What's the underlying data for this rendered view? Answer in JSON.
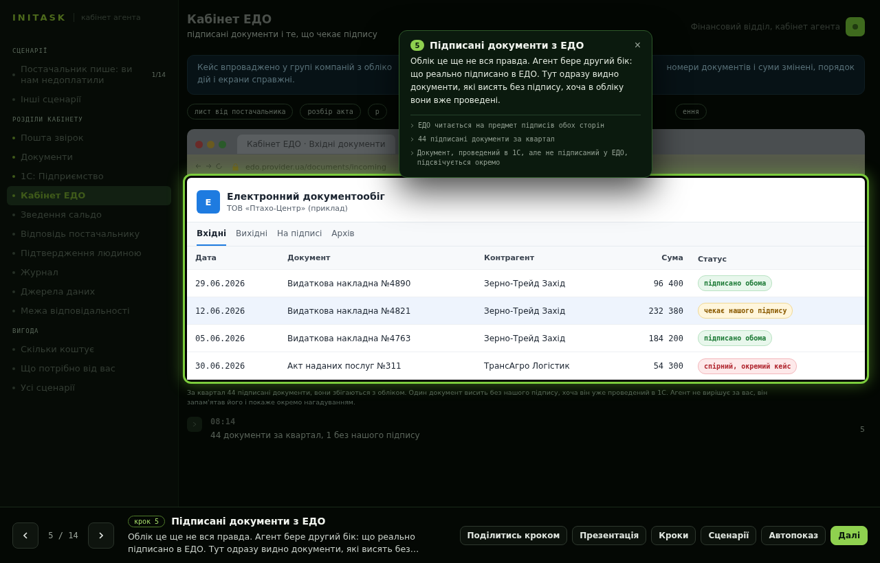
{
  "sidebar": {
    "logo": "INITASK",
    "subtitle": "кабінет агента",
    "sections": [
      {
        "title": "СЦЕНАРІЇ",
        "items": [
          {
            "label": "Постачальник пише: ви нам недоплатили",
            "count": "1/14",
            "selected": false,
            "done": false
          },
          {
            "label": "Інші сценарії",
            "selected": false,
            "done": false
          }
        ]
      },
      {
        "title": "РОЗДІЛИ КАБІНЕТУ",
        "items": [
          {
            "label": "Пошта звірок",
            "selected": false,
            "done": true
          },
          {
            "label": "Документи",
            "selected": false,
            "done": true
          },
          {
            "label": "1С: Підприємство",
            "selected": false,
            "done": true
          },
          {
            "label": "Кабінет ЕДО",
            "selected": true,
            "done": true
          },
          {
            "label": "Зведення сальдо",
            "selected": false,
            "done": false
          },
          {
            "label": "Відповідь постачальнику",
            "selected": false,
            "done": false
          },
          {
            "label": "Підтвердження людиною",
            "selected": false,
            "done": false
          },
          {
            "label": "Журнал",
            "selected": false,
            "done": false
          },
          {
            "label": "Джерела даних",
            "selected": false,
            "done": false
          },
          {
            "label": "Межа відповідальності",
            "selected": false,
            "done": false
          }
        ]
      },
      {
        "title": "ВИГОДА",
        "items": [
          {
            "label": "Скільки коштує",
            "selected": false,
            "done": false
          },
          {
            "label": "Що потрібно від вас",
            "selected": false,
            "done": false
          },
          {
            "label": "Усі сценарії",
            "selected": false,
            "done": false
          }
        ]
      }
    ]
  },
  "header": {
    "title": "Кабінет ЕДО",
    "subtitle": "підписані документи і те, що чекає підпису",
    "account": "Фінансовий відділ, кабінет агента"
  },
  "intro": {
    "text_start": "Кейс впроваджено у групі компаній з обліко",
    "text_end": "номери документів і суми змінені, порядок",
    "text_line2": "дій і екрани справжні."
  },
  "chips": [
    "лист від постачальника",
    "розбір акта",
    "р",
    "ення"
  ],
  "browser": {
    "tab": "Кабінет ЕДО · Вхідні документи",
    "url": "edo.provider.ua/documents/incoming"
  },
  "edo": {
    "logo": "Е",
    "title": "Електронний документообіг",
    "company": "ТОВ «Птахо-Центр» (приклад)",
    "tabs": [
      {
        "label": "Вхідні",
        "selected": true
      },
      {
        "label": "Вихідні",
        "selected": false
      },
      {
        "label": "На підписі",
        "selected": false
      },
      {
        "label": "Архів",
        "selected": false
      }
    ],
    "columns": [
      "Дата",
      "Документ",
      "Контрагент",
      "Сума",
      "Статус"
    ],
    "rows": [
      {
        "date": "29.06.2026",
        "document": "Видаткова накладна №4890",
        "counterparty": "Зерно-Трейд Захід",
        "sum": "96 400",
        "status": "підписано обома",
        "kind": "signed",
        "selected": false
      },
      {
        "date": "12.06.2026",
        "document": "Видаткова накладна №4821",
        "counterparty": "Зерно-Трейд Захід",
        "sum": "232 380",
        "status": "чекає нашого підпису",
        "kind": "pending",
        "selected": true
      },
      {
        "date": "05.06.2026",
        "document": "Видаткова накладна №4763",
        "counterparty": "Зерно-Трейд Захід",
        "sum": "184 200",
        "status": "підписано обома",
        "kind": "signed",
        "selected": false
      },
      {
        "date": "30.06.2026",
        "document": "Акт наданих послуг №311",
        "counterparty": "ТрансАгро Логістик",
        "sum": "54 300",
        "status": "спірний, окремий кейс",
        "kind": "disputed",
        "selected": false
      }
    ]
  },
  "note": "За квартал 44 підписані документи, вони збігаються з обліком. Один документ висить без нашого підпису, хоча він уже проведений в 1С. Агент не вирішує за вас, він",
  "note_line2": "запам'ятав його і покаже окремо нагадуванням.",
  "log": {
    "time": "08:14",
    "text": "44 документи за квартал, 1 без нашого підпису",
    "count": "5"
  },
  "tooltip": {
    "step": "5",
    "title": "Підписані документи з ЕДО",
    "close": "×",
    "text": "Облік це ще не вся правда. Агент бере другий бік: що реально підписано в ЕДО. Тут одразу видно документи, які висять без підпису, хоча в обліку вони вже проведені.",
    "points": [
      "ЕДО читається на предмет підписів обох сторін",
      "44 підписані документи за квартал",
      "Документ, проведений в 1С, але не підписаний у ЕДО, підсвічується окремо"
    ]
  },
  "footer": {
    "position": "5 / 14",
    "badge": "крок 5",
    "title": "Підписані документи з ЕДО",
    "text": "Облік це ще не вся правда. Агент бере другий бік: що реально підписано в ЕДО. Тут одразу видно документи, які висять без…",
    "buttons": [
      {
        "label": "Поділитись кроком",
        "kind": "secondary"
      },
      {
        "label": "Презентація",
        "kind": "secondary"
      },
      {
        "label": "Кроки",
        "kind": "secondary"
      },
      {
        "label": "Сценарії",
        "kind": "secondary"
      },
      {
        "label": "Автопоказ",
        "kind": "secondary"
      },
      {
        "label": "Далі",
        "kind": "primary"
      }
    ]
  }
}
